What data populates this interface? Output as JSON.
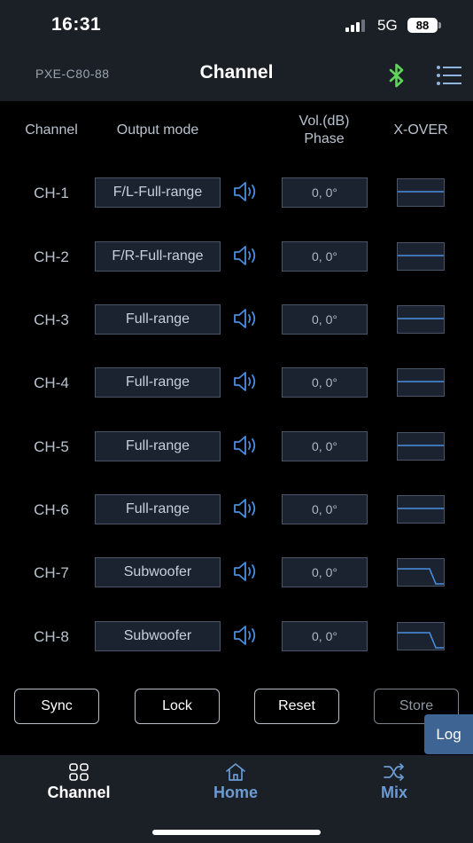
{
  "status_bar": {
    "time": "16:31",
    "network": "5G",
    "battery": "88"
  },
  "header": {
    "device": "PXE-C80-88",
    "title": "Channel"
  },
  "columns": {
    "channel": "Channel",
    "output_mode": "Output mode",
    "vol_line1": "Vol.(dB)",
    "vol_line2": "Phase",
    "xover": "X-OVER"
  },
  "channels": [
    {
      "label": "CH-1",
      "mode": "F/L-Full-range",
      "vol_phase": "0, 0°",
      "xover": "full"
    },
    {
      "label": "CH-2",
      "mode": "F/R-Full-range",
      "vol_phase": "0, 0°",
      "xover": "full"
    },
    {
      "label": "CH-3",
      "mode": "Full-range",
      "vol_phase": "0, 0°",
      "xover": "full"
    },
    {
      "label": "CH-4",
      "mode": "Full-range",
      "vol_phase": "0, 0°",
      "xover": "full"
    },
    {
      "label": "CH-5",
      "mode": "Full-range",
      "vol_phase": "0, 0°",
      "xover": "full"
    },
    {
      "label": "CH-6",
      "mode": "Full-range",
      "vol_phase": "0, 0°",
      "xover": "full"
    },
    {
      "label": "CH-7",
      "mode": "Subwoofer",
      "vol_phase": "0, 0°",
      "xover": "lowpass"
    },
    {
      "label": "CH-8",
      "mode": "Subwoofer",
      "vol_phase": "0, 0°",
      "xover": "lowpass"
    }
  ],
  "actions": {
    "sync": "Sync",
    "lock": "Lock",
    "reset": "Reset",
    "store": "Store",
    "log": "Log"
  },
  "nav": {
    "channel": {
      "label": "Channel",
      "active": true
    },
    "home": {
      "label": "Home",
      "active": false
    },
    "mix": {
      "label": "Mix",
      "active": false
    }
  },
  "colors": {
    "accent_blue": "#4a8ee0",
    "bluetooth_green": "#5fd35a",
    "nav_inactive": "#6a9bd3",
    "background": "#000000",
    "panel": "#1b1f26"
  },
  "icons": {
    "bluetooth": "bluetooth-icon",
    "menu": "menu-list-icon",
    "speaker": "speaker-icon",
    "channel": "grid-icon",
    "home": "home-icon",
    "mix": "shuffle-icon"
  }
}
